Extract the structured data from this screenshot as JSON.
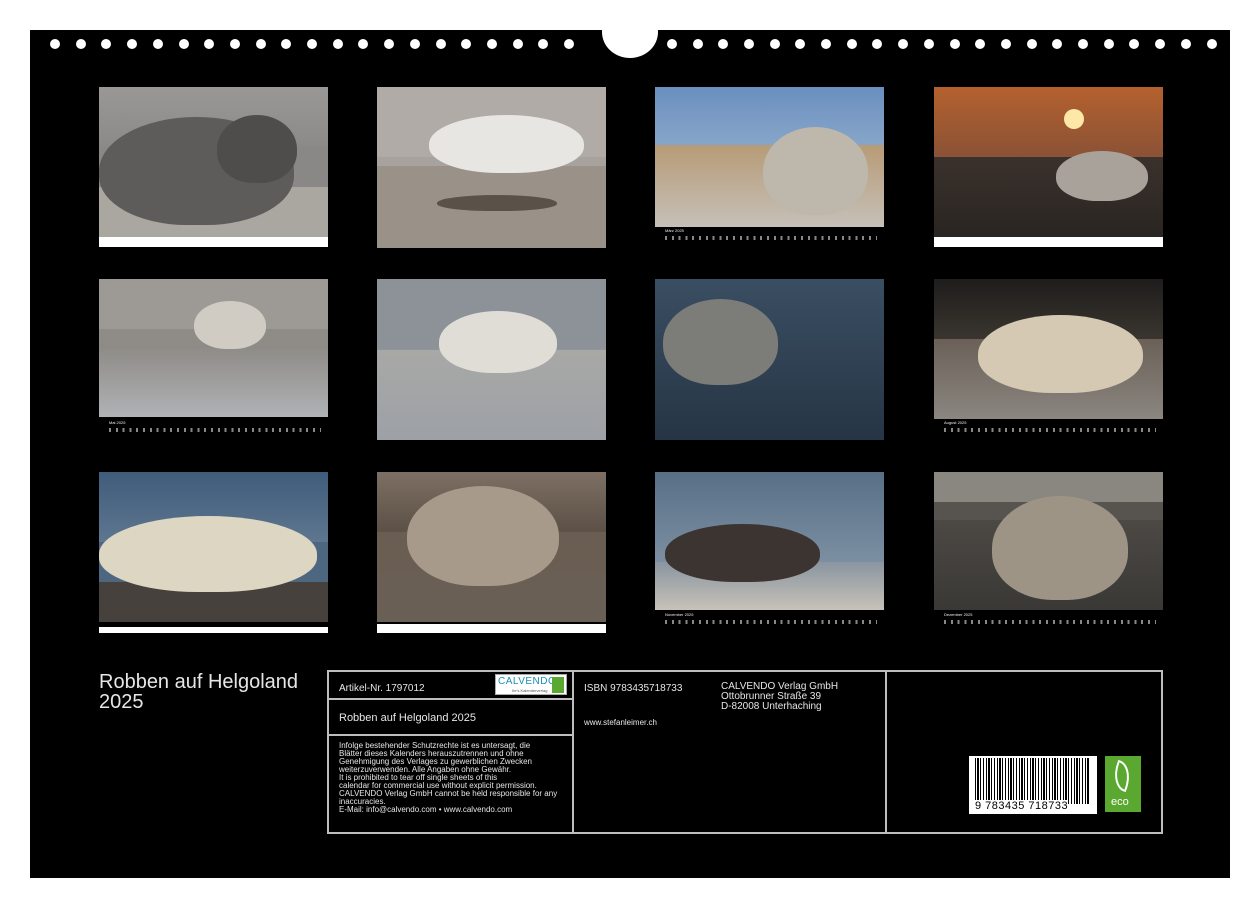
{
  "calendar": {
    "title": "Robben auf Helgoland 2025",
    "months": [
      {
        "label": ""
      },
      {
        "label": ""
      },
      {
        "label": "März 2025"
      },
      {
        "label": ""
      },
      {
        "label": "Mai 2025"
      },
      {
        "label": ""
      },
      {
        "label": ""
      },
      {
        "label": "August 2025"
      },
      {
        "label": ""
      },
      {
        "label": ""
      },
      {
        "label": "November 2025"
      },
      {
        "label": "Dezember 2025"
      }
    ]
  },
  "info": {
    "article_number": "Artikel-Nr. 1797012",
    "product_title": "Robben auf Helgoland 2025",
    "legal_lines": [
      "Infolge bestehender Schutzrechte ist es untersagt, die",
      "Blätter dieses Kalenders herauszutrennen und ohne",
      "Genehmigung des Verlages zu gewerblichen Zwecken",
      "weiterzuverwenden. Alle Angaben ohne Gewähr.",
      "It is prohibited to tear off single sheets of this",
      "calendar for commercial use without explicit permission.",
      "CALVENDO Verlag GmbH cannot be held responsible for any",
      "inaccuracies.",
      "E-Mail: info@calvendo.com • www.calvendo.com"
    ],
    "isbn": "ISBN 9783435718733",
    "website": "www.stefanleimer.ch",
    "publisher_lines": [
      "CALVENDO Verlag GmbH",
      "Ottobrunner Straße 39",
      "D-82008 Unterhaching"
    ],
    "barcode_number": "9 783435 718733",
    "logo_text": "CALVENDO",
    "logo_tagline": "Ihr's Kalenderverlag",
    "eco_label": "eco"
  }
}
